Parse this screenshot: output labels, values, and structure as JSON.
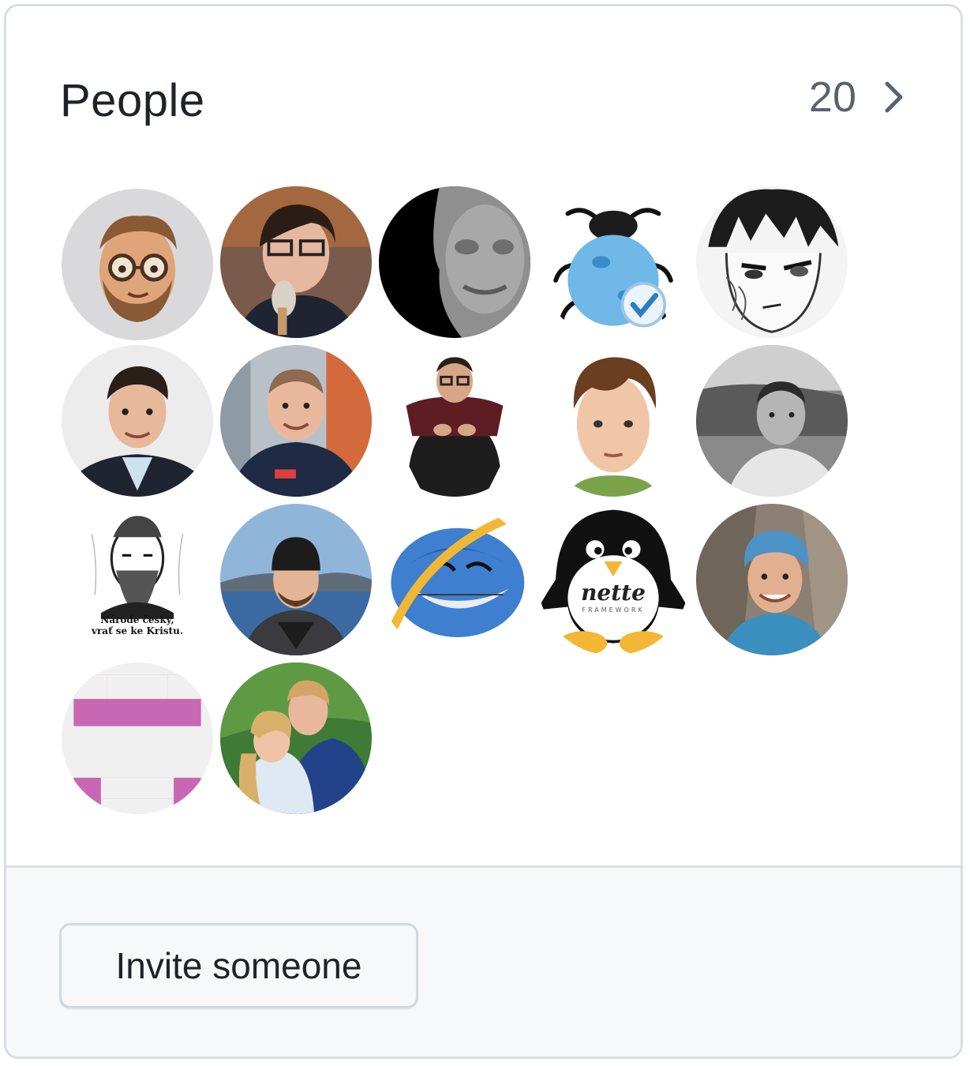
{
  "people": {
    "title": "People",
    "count": "20",
    "chevron_icon": "chevron-right-icon"
  },
  "avatars": [
    {
      "name": "avatar-memoji-beard-glasses",
      "desc_icon": "memoji"
    },
    {
      "name": "avatar-man-glasses-eating",
      "desc_icon": "photo"
    },
    {
      "name": "avatar-stone-face",
      "desc_icon": "photo"
    },
    {
      "name": "avatar-blue-bug-check",
      "desc_icon": "bug-check-icon"
    },
    {
      "name": "avatar-anime-face",
      "desc_icon": "drawing"
    },
    {
      "name": "avatar-man-suit",
      "desc_icon": "photo"
    },
    {
      "name": "avatar-man-tshirt-smiling",
      "desc_icon": "photo"
    },
    {
      "name": "avatar-man-crouching",
      "desc_icon": "photo"
    },
    {
      "name": "avatar-young-man-portrait",
      "desc_icon": "photo"
    },
    {
      "name": "avatar-man-grayscale",
      "desc_icon": "photo"
    },
    {
      "name": "avatar-engraving-portrait",
      "desc_icon": "engraving",
      "caption_lines": [
        "Národe český,",
        "vrať se ke Kristu."
      ]
    },
    {
      "name": "avatar-man-beanie-lake",
      "desc_icon": "photo"
    },
    {
      "name": "avatar-ie-trollface",
      "desc_icon": "trollface-icon"
    },
    {
      "name": "avatar-nette-penguin",
      "desc_icon": "penguin-icon",
      "logo_text": "nette",
      "logo_sub": "FRAMEWORK"
    },
    {
      "name": "avatar-man-headscarf-rock",
      "desc_icon": "photo"
    },
    {
      "name": "avatar-pink-identicon",
      "desc_icon": "identicon"
    },
    {
      "name": "avatar-couple",
      "desc_icon": "photo"
    }
  ],
  "footer": {
    "invite_label": "Invite someone"
  },
  "colors": {
    "border": "#d8dee4",
    "text": "#1f2328",
    "muted": "#59636e",
    "footer_bg": "#f6f8fa",
    "identicon_pink": "#c868b4"
  }
}
